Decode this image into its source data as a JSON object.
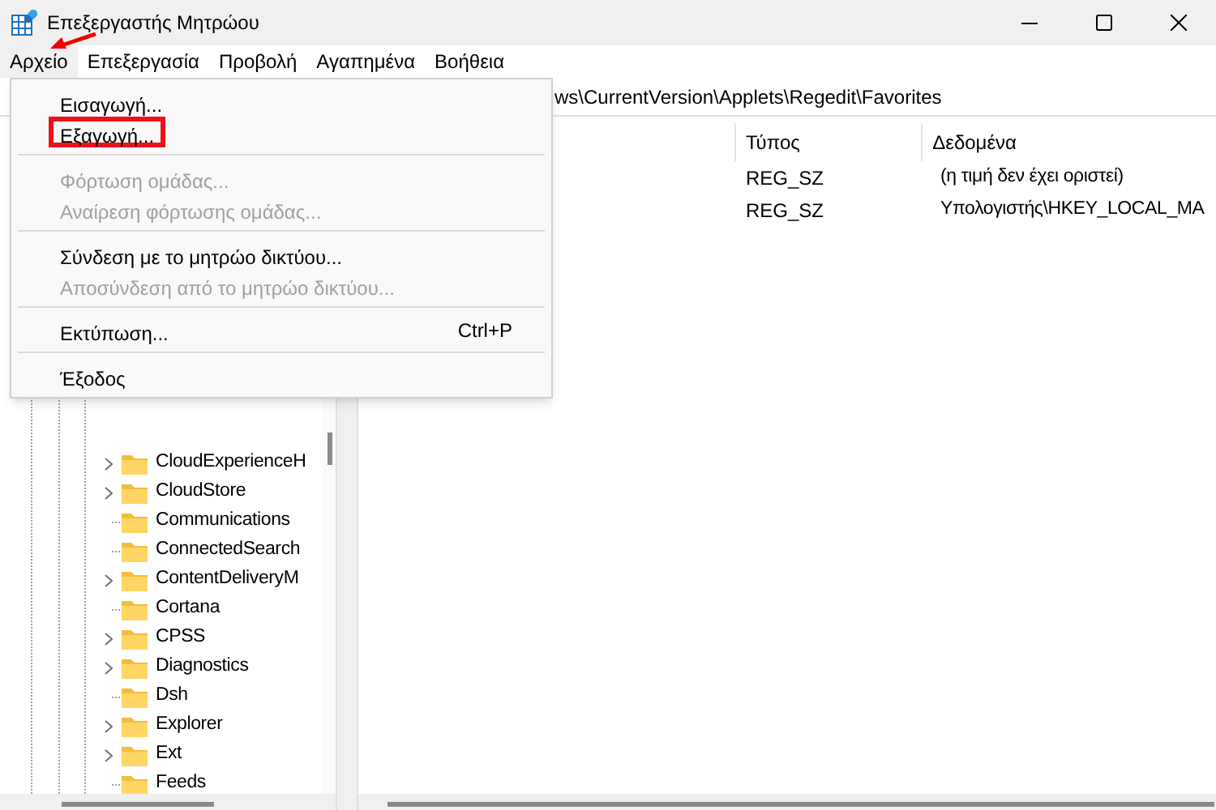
{
  "window": {
    "title": "Επεξεργαστής Μητρώου"
  },
  "menu_bar": [
    {
      "label": "Αρχείο",
      "selected": true
    },
    {
      "label": "Επεξεργασία",
      "selected": false
    },
    {
      "label": "Προβολή",
      "selected": false
    },
    {
      "label": "Αγαπημένα",
      "selected": false
    },
    {
      "label": "Βοήθεια",
      "selected": false
    }
  ],
  "address_bar": {
    "value": "ws\\CurrentVersion\\Applets\\Regedit\\Favorites"
  },
  "tree": {
    "items": [
      {
        "label": "CloudExperienceH",
        "expandable": true
      },
      {
        "label": "CloudStore",
        "expandable": true
      },
      {
        "label": "Communications",
        "expandable": false
      },
      {
        "label": "ConnectedSearch",
        "expandable": false
      },
      {
        "label": "ContentDeliveryM",
        "expandable": true
      },
      {
        "label": "Cortana",
        "expandable": false
      },
      {
        "label": "CPSS",
        "expandable": true
      },
      {
        "label": "Diagnostics",
        "expandable": true
      },
      {
        "label": "Dsh",
        "expandable": false
      },
      {
        "label": "Explorer",
        "expandable": true
      },
      {
        "label": "Ext",
        "expandable": true
      },
      {
        "label": "Feeds",
        "expandable": false
      }
    ]
  },
  "values_table": {
    "columns": [
      "Τύπος",
      "Δεδομένα"
    ],
    "rows": [
      {
        "type": "REG_SZ",
        "data": "(η τιμή δεν έχει οριστεί)"
      },
      {
        "type": "REG_SZ",
        "data": "Υπολογιστής\\HKEY_LOCAL_MA"
      }
    ]
  },
  "file_menu": [
    {
      "kind": "item",
      "label": "Εισαγωγή...",
      "disabled": false,
      "highlighted": false
    },
    {
      "kind": "item",
      "label": "Εξαγωγή...",
      "disabled": false,
      "highlighted": true
    },
    {
      "kind": "separator"
    },
    {
      "kind": "item",
      "label": "Φόρτωση ομάδας...",
      "disabled": true,
      "highlighted": false
    },
    {
      "kind": "item",
      "label": "Αναίρεση φόρτωσης ομάδας...",
      "disabled": true,
      "highlighted": false
    },
    {
      "kind": "separator"
    },
    {
      "kind": "item",
      "label": "Σύνδεση με το μητρώο δικτύου...",
      "disabled": false,
      "highlighted": false
    },
    {
      "kind": "item",
      "label": "Αποσύνδεση από το μητρώο δικτύου...",
      "disabled": true,
      "highlighted": false
    },
    {
      "kind": "separator"
    },
    {
      "kind": "item",
      "label": "Εκτύπωση...",
      "shortcut": "Ctrl+P",
      "disabled": false,
      "highlighted": false
    },
    {
      "kind": "separator"
    },
    {
      "kind": "item",
      "label": "Έξοδος",
      "disabled": false,
      "highlighted": false
    }
  ]
}
